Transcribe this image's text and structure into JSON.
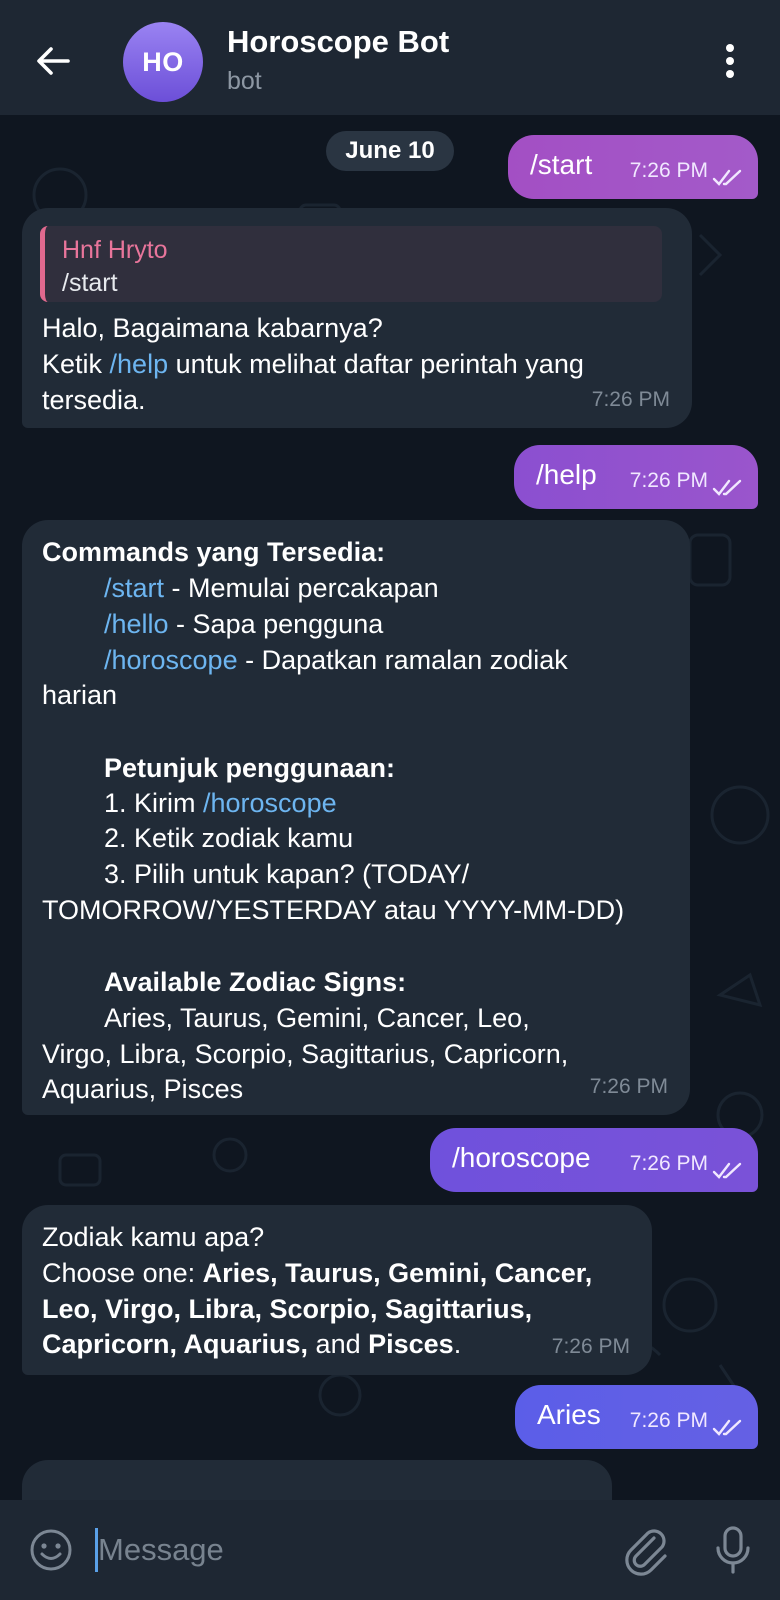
{
  "header": {
    "avatar_initials": "HO",
    "title": "Horoscope Bot",
    "subtitle": "bot"
  },
  "chat": {
    "date": "June 10",
    "messages": {
      "m1": {
        "text": "/start",
        "time": "7:26 PM"
      },
      "m2": {
        "reply_name": "Hnf Hryto",
        "reply_text": "/start",
        "line1": "Halo, Bagaimana kabarnya?",
        "line2_a": "Ketik ",
        "line2_link": "/help",
        "line2_b": " untuk melihat daftar perintah yang",
        "line3": "tersedia.",
        "time": "7:26 PM"
      },
      "m3": {
        "text": "/help",
        "time": "7:26 PM"
      },
      "m4": {
        "heading": "Commands yang Tersedia:",
        "cmd1": "/start",
        "cmd1_desc": " - Memulai percakapan",
        "cmd2": "/hello",
        "cmd2_desc": " - Sapa pengguna",
        "cmd3": "/horoscope",
        "cmd3_desc": " - Dapatkan ramalan zodiak",
        "cmd3_wrap": "harian",
        "usage_heading": "Petunjuk penggunaan:",
        "step1_a": "1. Kirim ",
        "step1_link": "/horoscope",
        "step2": "2. Ketik zodiak kamu",
        "step3": "3. Pilih untuk kapan? (TODAY/",
        "step3_wrap": "TOMORROW/YESTERDAY atau YYYY-MM-DD)",
        "signs_heading": "Available Zodiac Signs:",
        "signs1": "Aries, Taurus, Gemini, Cancer, Leo,",
        "signs2": "Virgo, Libra, Scorpio, Sagittarius, Capricorn,",
        "signs3": "Aquarius, Pisces",
        "time": "7:26 PM"
      },
      "m5": {
        "text": "/horoscope",
        "time": "7:26 PM"
      },
      "m6": {
        "line1": "Zodiak kamu apa?",
        "line2_a": "Choose one: ",
        "line2_b": "Aries, Taurus, Gemini, Cancer,",
        "line3": "Leo, Virgo, Libra, Scorpio, Sagittarius,",
        "line4_a": "Capricorn, Aquarius,",
        "line4_b": " and ",
        "line4_c": "Pisces",
        "line4_d": ".",
        "time": "7:26 PM"
      },
      "m7": {
        "text": "Aries",
        "time": "7:26 PM"
      }
    }
  },
  "composer": {
    "placeholder": "Message"
  },
  "colors": {
    "header_bg": "#1e2733",
    "chat_bg": "#0f1620",
    "incoming_bubble": "#212b37",
    "link": "#6db5f0",
    "reply_accent": "#e0698e"
  },
  "icons": [
    "back-arrow-icon",
    "more-vertical-icon",
    "double-check-icon",
    "emoji-icon",
    "attach-icon",
    "mic-icon"
  ]
}
